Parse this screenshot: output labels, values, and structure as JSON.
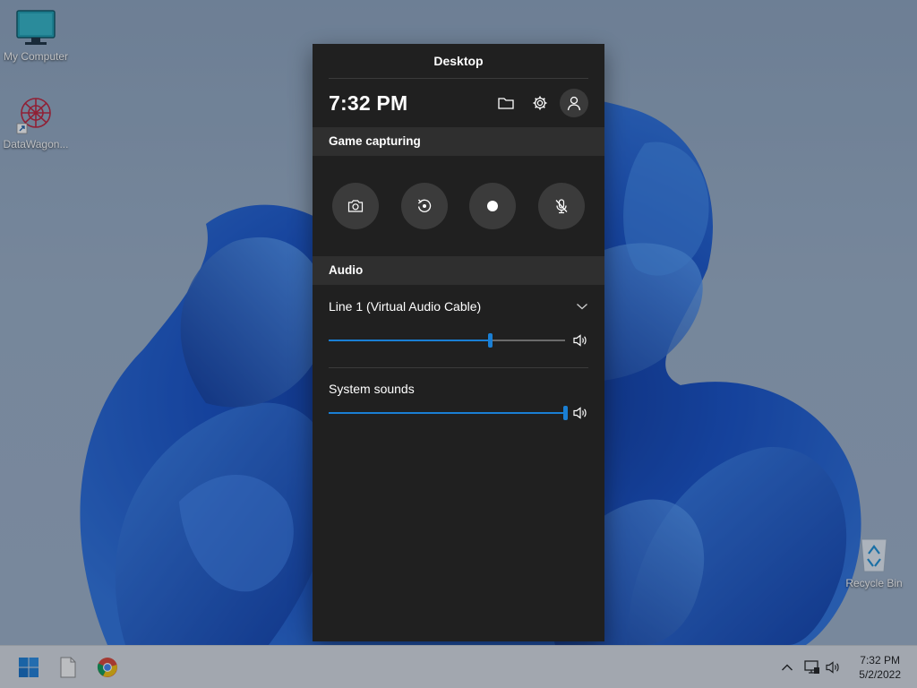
{
  "desktop": {
    "icons": [
      {
        "label": "My Computer",
        "icon": "monitor-icon"
      },
      {
        "label": "DataWagon...",
        "icon": "datawagon-app-icon"
      },
      {
        "label": "Recycle Bin",
        "icon": "recycle-bin-icon"
      }
    ]
  },
  "gamebar": {
    "title": "Desktop",
    "time": "7:32 PM",
    "header_icons": [
      "folder-icon",
      "gear-icon",
      "user-icon"
    ],
    "capture": {
      "section_title": "Game capturing",
      "buttons": [
        "screenshot-camera-icon",
        "record-last-30s-icon",
        "start-recording-icon",
        "mic-muted-icon"
      ]
    },
    "audio": {
      "section_title": "Audio",
      "device": {
        "label": "Line 1 (Virtual Audio Cable)",
        "volume": 0.68
      },
      "system": {
        "label": "System sounds",
        "volume": 1.0
      }
    },
    "accent": "#1a7fd4"
  },
  "taskbar": {
    "apps": [
      "windows-start-icon",
      "file-explorer-icon",
      "chrome-icon"
    ],
    "tray": [
      "chevron-up-icon",
      "network-icon",
      "speaker-icon"
    ],
    "clock_time": "7:32 PM",
    "clock_date": "5/2/2022"
  }
}
